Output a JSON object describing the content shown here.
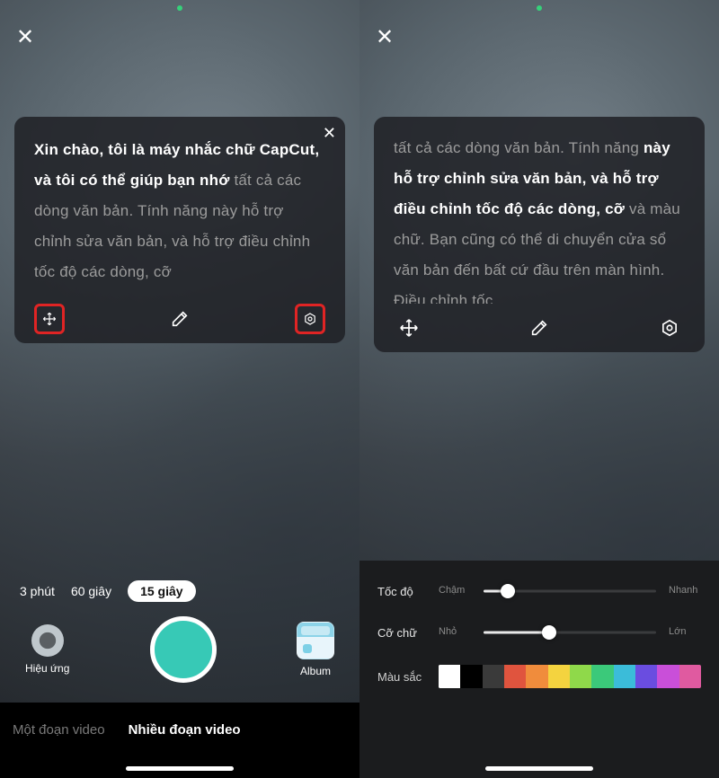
{
  "left": {
    "card": {
      "line_bright": "Xin chào, tôi là máy nhắc chữ CapCut, và tôi có thể giúp bạn nhớ",
      "line_dim": "tất cả các dòng văn bản. Tính năng này hỗ trợ chỉnh sửa văn bản, và hỗ trợ điều chỉnh tốc độ các dòng, cỡ"
    },
    "durations": {
      "a": "3 phút",
      "b": "60 giây",
      "c": "15 giây"
    },
    "effects_label": "Hiệu ứng",
    "album_label": "Album",
    "tabs": {
      "single": "Một đoạn video",
      "multi": "Nhiều đoạn video"
    }
  },
  "right": {
    "card": {
      "line_dim1": "tất cả các dòng văn bản. Tính năng",
      "line_bright": "này hỗ trợ chỉnh sửa văn bản, và hỗ trợ điều chỉnh tốc độ các dòng, cỡ",
      "line_dim2": "và màu chữ. Bạn cũng có thể di chuyển cửa sổ văn bản đến bất cứ đầu trên màn hình. Điều chỉnh tốc"
    },
    "settings": {
      "speed_label": "Tốc độ",
      "speed_min": "Chậm",
      "speed_max": "Nhanh",
      "size_label": "Cỡ chữ",
      "size_min": "Nhỏ",
      "size_max": "Lớn",
      "color_label": "Màu sắc"
    },
    "palette": [
      "#ffffff",
      "#000000",
      "#3a3a3a",
      "#e0543e",
      "#f08c3c",
      "#f4d33f",
      "#8fd94a",
      "#3bc97a",
      "#3bbcd9",
      "#6a4de0",
      "#c94fd9",
      "#e05aa0"
    ]
  }
}
